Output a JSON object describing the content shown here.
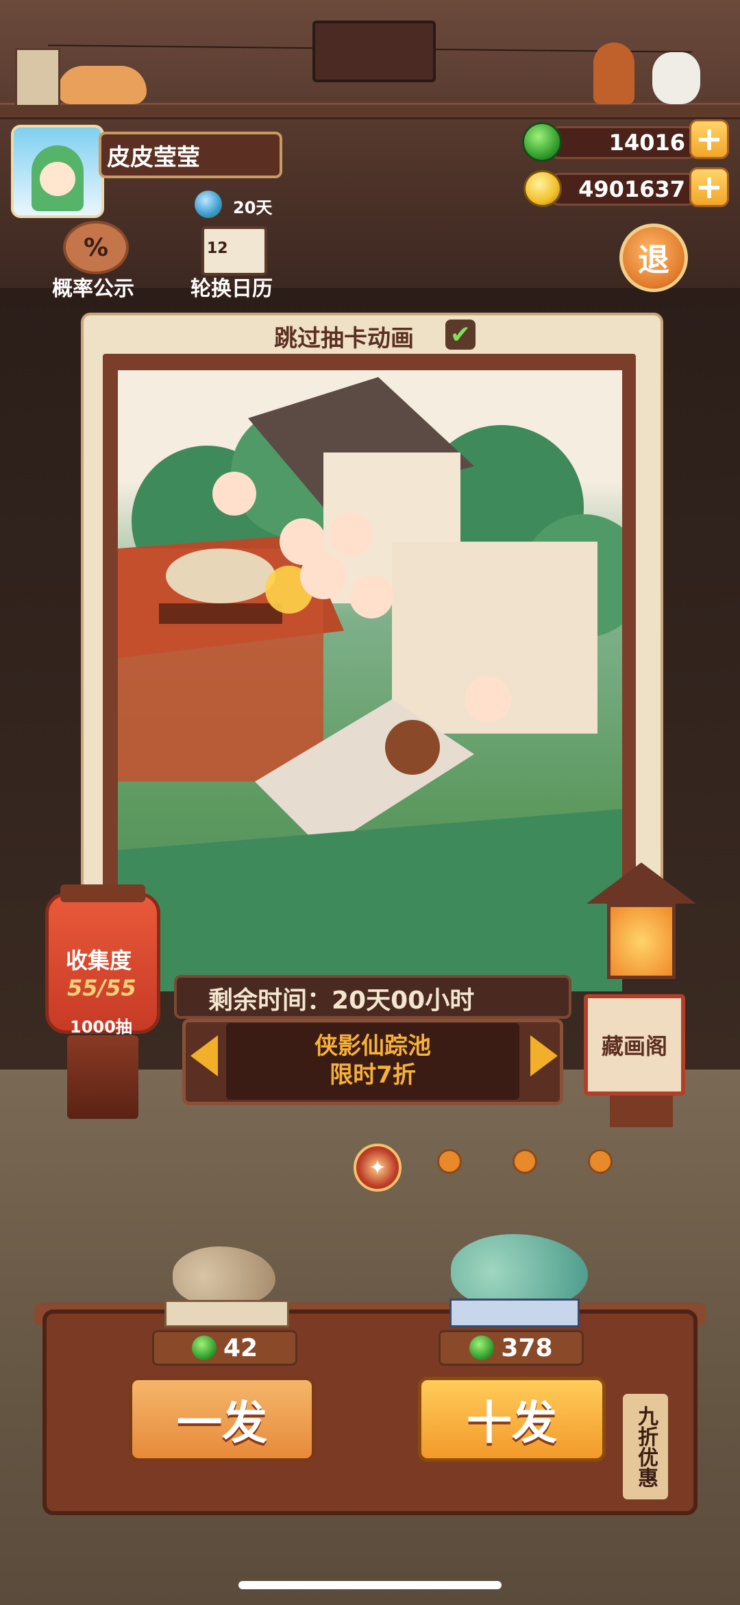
{
  "player": {
    "name": "皮皮莹莹",
    "days": "20天"
  },
  "currency": {
    "jade": "14016",
    "coins": "4901637",
    "plus": "+"
  },
  "top_buttons": {
    "probability_icon": "%",
    "probability_label": "概率公示",
    "calendar_number": "12",
    "calendar_label": "轮换日历",
    "exit_label": "退"
  },
  "card": {
    "skip_animation_label": "跳过抽卡动画",
    "skip_checked": true,
    "check_glyph": "✔"
  },
  "collection": {
    "title": "收集度",
    "count": "55/55",
    "draws": "1000抽"
  },
  "pool": {
    "remaining_time": "剩余时间：20天00小时",
    "name": "侠影仙踪池",
    "discount": "限时7折"
  },
  "gallery": {
    "label": "藏画阁"
  },
  "pagination": {
    "active_icon": "✦",
    "total": 4,
    "active_index": 0
  },
  "draw": {
    "single_label": "一发",
    "single_price": "42",
    "ten_label": "十发",
    "ten_price": "378",
    "discount_tag": "九折优惠"
  },
  "colors": {
    "accent": "#f2a528",
    "pool_text": "#f7b13a",
    "jade": "#2f9a2a"
  }
}
